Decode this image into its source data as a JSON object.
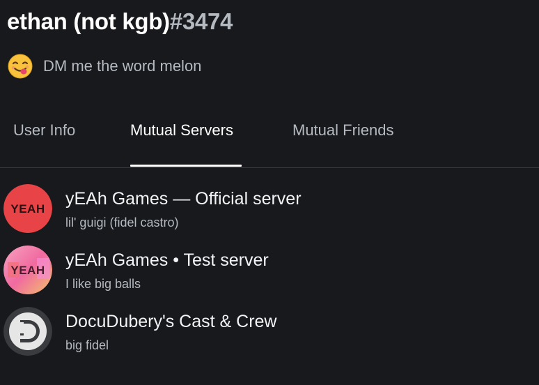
{
  "profile": {
    "username": "ethan (not kgb)",
    "discriminator": "#3474",
    "status_emoji": "face-savoring-food-icon",
    "status_text": "DM me the word melon"
  },
  "tabs": [
    {
      "label": "User Info",
      "active": false
    },
    {
      "label": "Mutual Servers",
      "active": true
    },
    {
      "label": "Mutual Friends",
      "active": false
    }
  ],
  "servers": [
    {
      "name": "yEAh Games — Official server",
      "nickname": "lil' guigi (fidel castro)",
      "icon": "yeah-games-red-logo-icon",
      "icon_text": "YEAH",
      "color": "#e84346"
    },
    {
      "name": "yEAh Games • Test server",
      "nickname": "I like big balls",
      "icon": "yeah-games-pink-logo-icon",
      "icon_text": "YEAH",
      "color": "#f06aa0"
    },
    {
      "name": "DocuDubery's Cast & Crew",
      "nickname": "big fidel",
      "icon": "docudubery-logo-icon",
      "color": "#3a3b3f"
    }
  ],
  "colors": {
    "background": "#18191c",
    "text_primary": "#ffffff",
    "text_muted": "#b5bac1",
    "divider": "#3a3c41"
  }
}
